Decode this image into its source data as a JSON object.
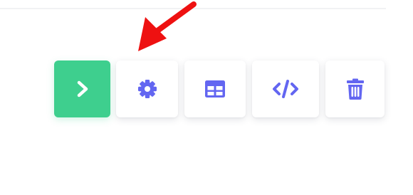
{
  "toolbar": {
    "buttons": [
      {
        "name": "run",
        "icon": "chevron-right-icon"
      },
      {
        "name": "settings",
        "icon": "gear-icon"
      },
      {
        "name": "table",
        "icon": "table-icon"
      },
      {
        "name": "code",
        "icon": "code-icon"
      },
      {
        "name": "delete",
        "icon": "trash-icon"
      }
    ]
  },
  "colors": {
    "primary_green": "#3ecf8e",
    "icon_indigo": "#6366f1",
    "annotation_red": "#ee1111"
  },
  "annotation": {
    "icon": "red-arrow-icon"
  }
}
